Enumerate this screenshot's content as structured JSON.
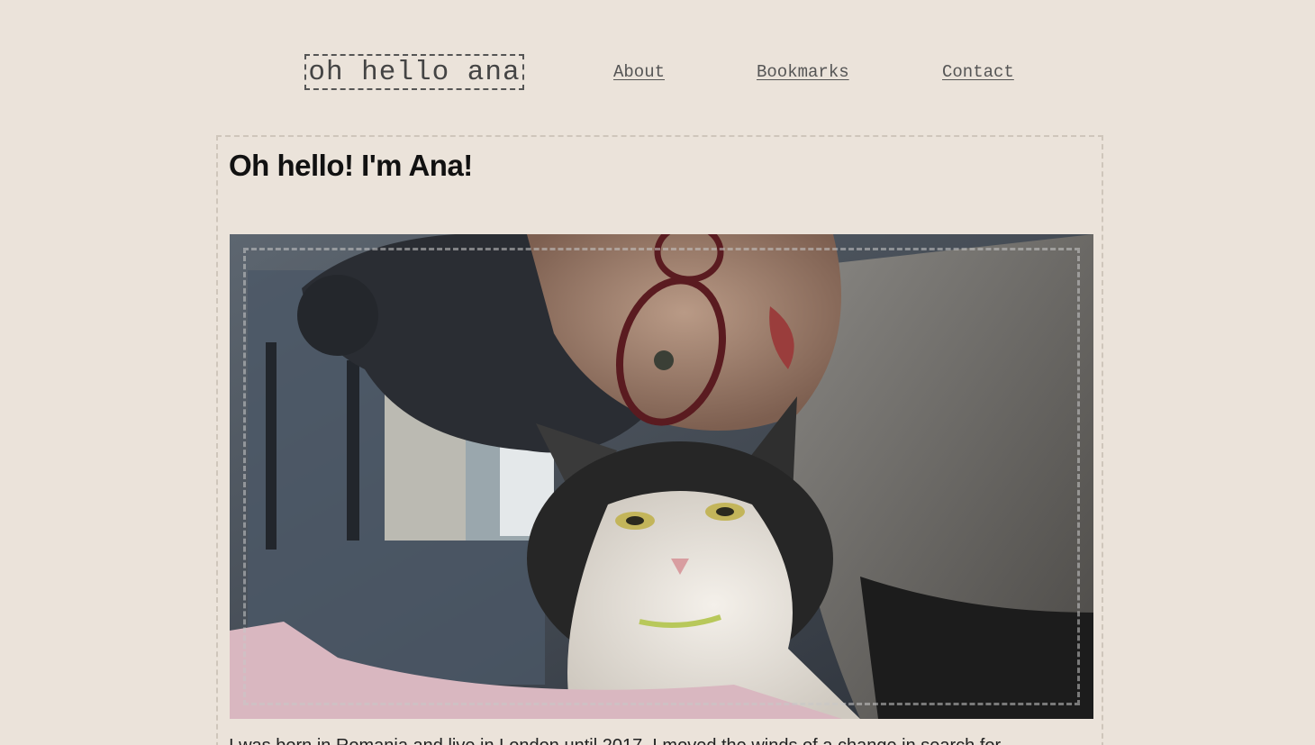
{
  "header": {
    "logo_text": "oh hello ana",
    "nav": [
      {
        "label": "About"
      },
      {
        "label": "Bookmarks"
      },
      {
        "label": "Contact"
      }
    ]
  },
  "main": {
    "title": "Oh hello! I'm Ana!",
    "photo": {
      "subject": "selfie of a woman with glasses and a black-and-white cat"
    },
    "intro_partial": "I was born in Romania and live in London until 2017. I moved the winds of a change in search for"
  },
  "colors": {
    "background": "#ebe3da",
    "logo_border": "#555555",
    "card_border": "#cfc6bb"
  }
}
